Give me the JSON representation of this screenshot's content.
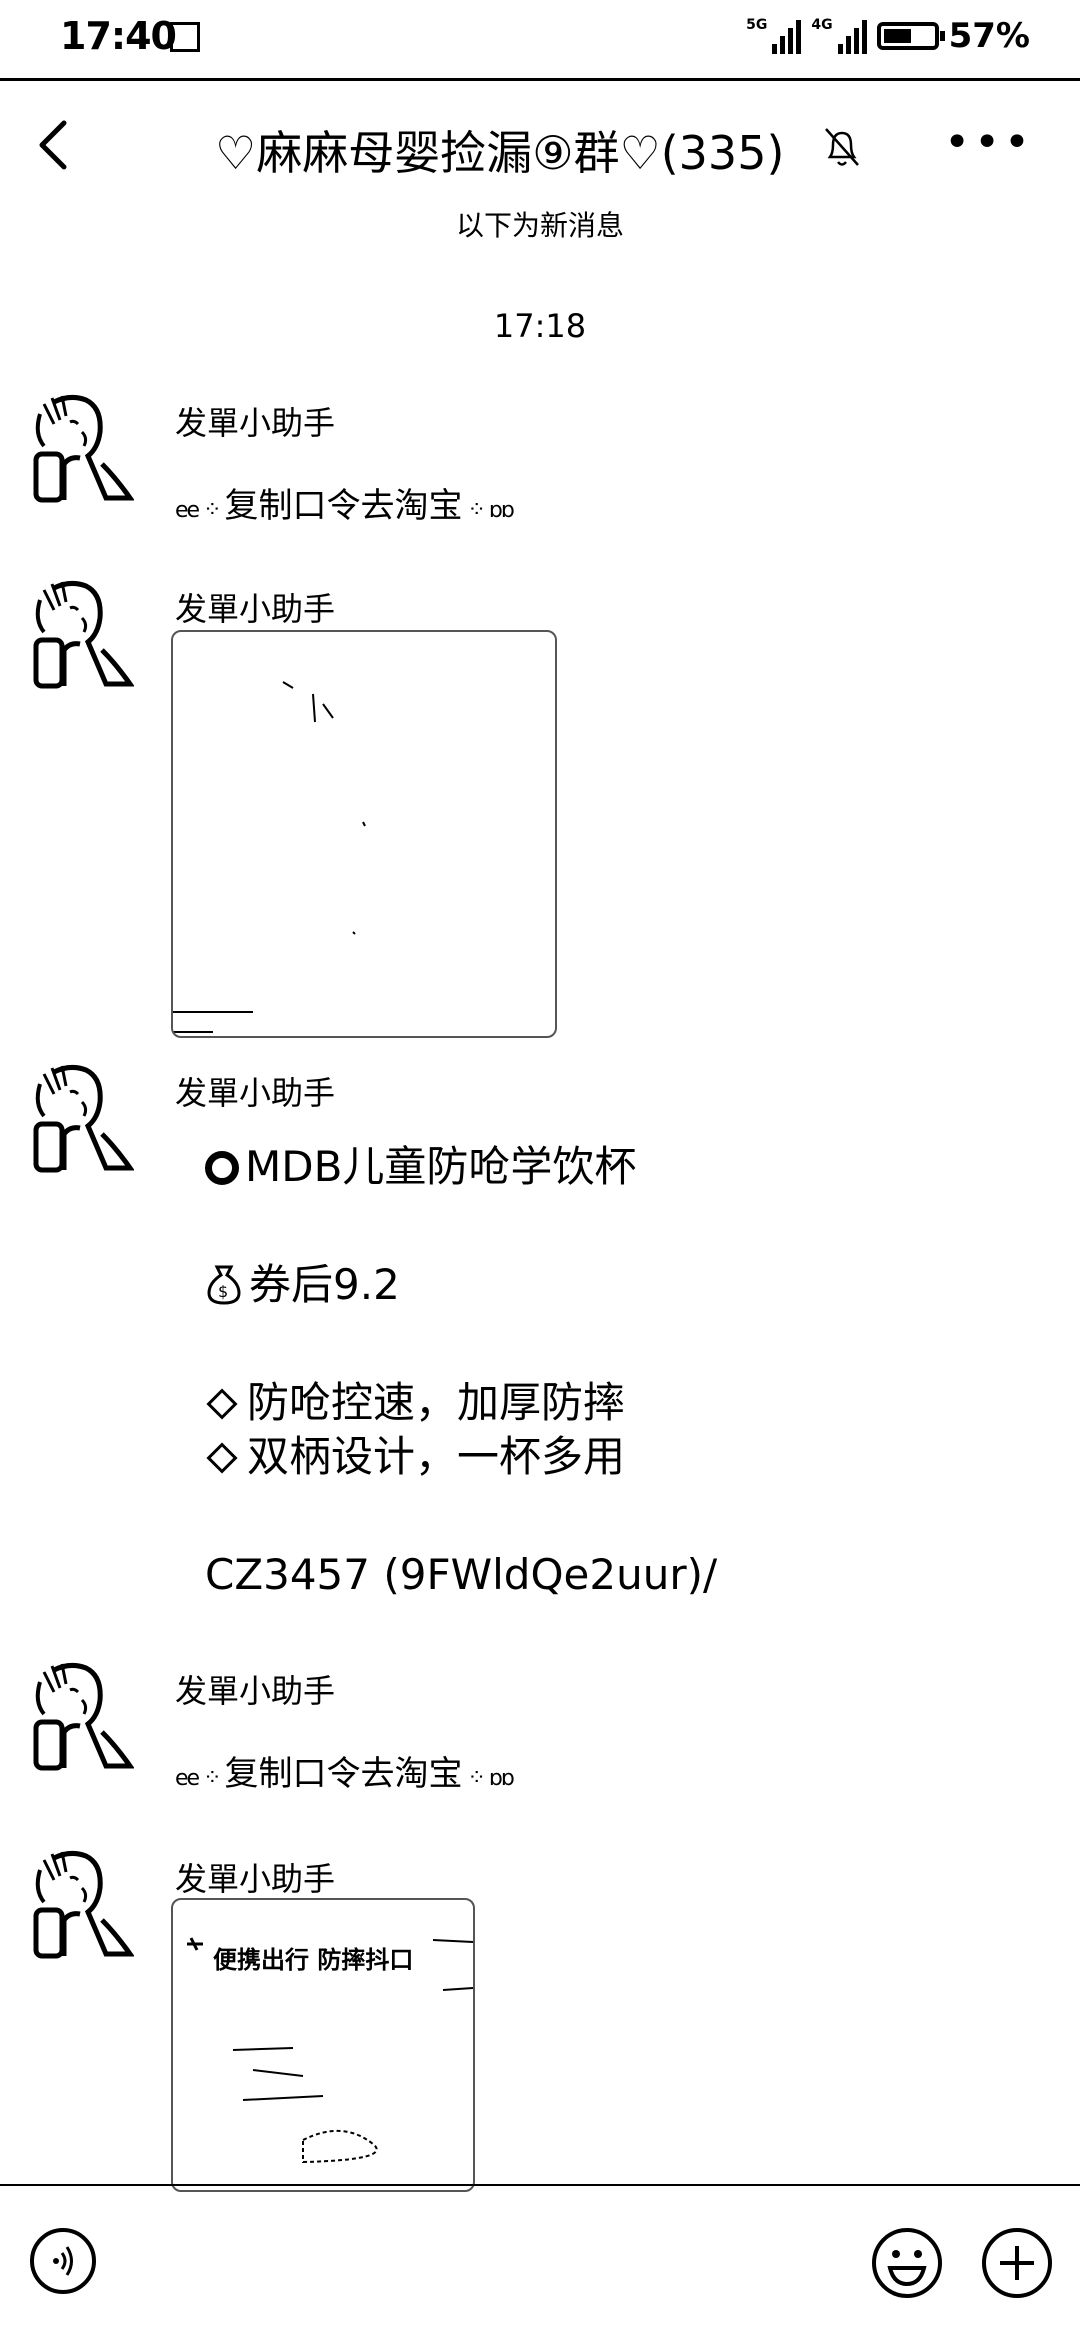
{
  "status_bar": {
    "time": "17:40",
    "network_1": "5G",
    "network_2": "4G",
    "battery_percent": "57%",
    "battery_level": 0.57
  },
  "header": {
    "title": "♡麻麻母婴捡漏⑨群♡(335)",
    "back_icon": "chevron-left-icon",
    "mute_icon": "bell-off-icon",
    "more_icon": "more-horizontal-icon"
  },
  "divider_text": "以下为新消息",
  "timestamp": "17:18",
  "messages": [
    {
      "sender": "发單小助手",
      "type": "text",
      "text": "复制口令去淘宝"
    },
    {
      "sender": "发單小助手",
      "type": "image"
    },
    {
      "sender": "发單小助手",
      "type": "product",
      "product_name": "MDB儿童防呛学饮杯",
      "price": "券后9.2",
      "feature_1": "防呛控速，加厚防摔",
      "feature_2": "双柄设计，一杯多用",
      "code": "CZ3457 (9FWldQe2uur)/"
    },
    {
      "sender": "发單小助手",
      "type": "text",
      "text": "复制口令去淘宝"
    },
    {
      "sender": "发單小助手",
      "type": "image",
      "caption": "便携出行 防摔抖口"
    }
  ],
  "input_bar": {
    "voice_icon": "voice-icon",
    "emoji_icon": "emoji-icon",
    "plus_icon": "plus-icon"
  }
}
